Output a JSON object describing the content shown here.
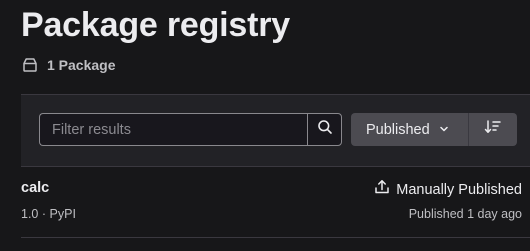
{
  "header": {
    "title": "Package registry",
    "package_count": "1 Package"
  },
  "filter": {
    "search_placeholder": "Filter results",
    "search_value": "",
    "sort_by": "Published"
  },
  "packages": [
    {
      "name": "calc",
      "version": "1.0",
      "separator": "·",
      "type": "PyPI",
      "status": "Manually Published",
      "published": "Published 1 day ago"
    }
  ],
  "icons": {
    "package": "package-icon",
    "search": "search-icon",
    "chevron": "chevron-down-icon",
    "sort_direction": "sort-lowest-icon",
    "upload": "upload-icon"
  }
}
